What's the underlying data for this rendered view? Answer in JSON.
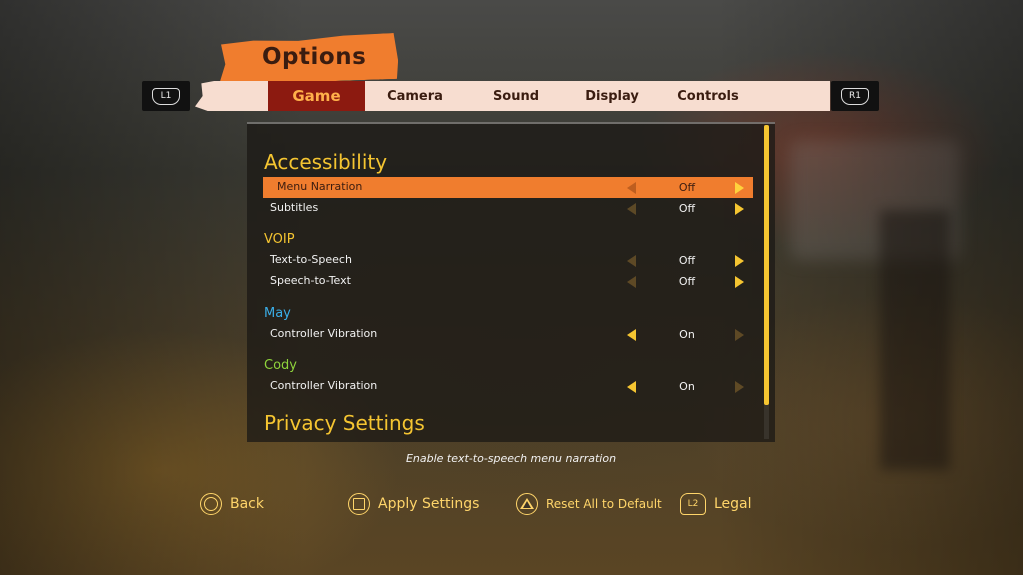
{
  "screen": {
    "title": "Options",
    "shoulder_left": "L1",
    "shoulder_right": "R1",
    "accent_color": "#f07d2e"
  },
  "tabs": [
    {
      "label": "Game",
      "active": true
    },
    {
      "label": "Camera",
      "active": false
    },
    {
      "label": "Sound",
      "active": false
    },
    {
      "label": "Display",
      "active": false
    },
    {
      "label": "Controls",
      "active": false
    }
  ],
  "sections": {
    "accessibility": {
      "heading": "Accessibility",
      "rows": [
        {
          "label": "Menu Narration",
          "value": "Off",
          "selected": true
        },
        {
          "label": "Subtitles",
          "value": "Off",
          "selected": false
        }
      ]
    },
    "voip": {
      "heading": "VOIP",
      "rows": [
        {
          "label": "Text-to-Speech",
          "value": "Off"
        },
        {
          "label": "Speech-to-Text",
          "value": "Off"
        }
      ]
    },
    "may": {
      "heading": "May",
      "heading_color": "#3aaee8",
      "rows": [
        {
          "label": "Controller Vibration",
          "value": "On"
        }
      ]
    },
    "cody": {
      "heading": "Cody",
      "heading_color": "#8fd43c",
      "rows": [
        {
          "label": "Controller Vibration",
          "value": "On"
        }
      ]
    },
    "privacy": {
      "heading": "Privacy Settings"
    }
  },
  "description": "Enable text-to-speech menu narration",
  "footer": {
    "back": {
      "icon": "circle-button-icon",
      "label": "Back"
    },
    "apply": {
      "icon": "square-button-icon",
      "label": "Apply Settings"
    },
    "reset": {
      "icon": "triangle-button-icon",
      "label": "Reset All to Default"
    },
    "legal": {
      "icon": "l2-button-icon",
      "glyph": "L2",
      "label": "Legal"
    }
  }
}
